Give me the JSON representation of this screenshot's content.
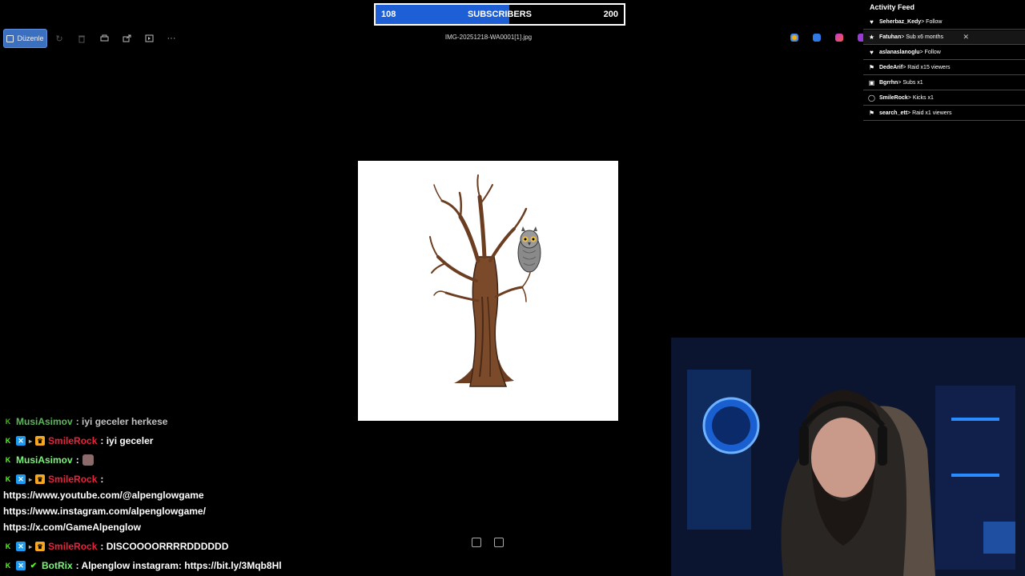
{
  "subscribers": {
    "current": "108",
    "title": "SUBSCRIBERS",
    "goal": "200",
    "progress": 0.54,
    "fill_color": "#1f5fd6"
  },
  "viewer": {
    "edit_label": "Düzenle",
    "filename": "IMG-20251218-WA0001[1].jpg",
    "icons": [
      "rotate-icon",
      "delete-icon",
      "print-icon",
      "share-icon",
      "slideshow-icon",
      "more-icon"
    ]
  },
  "activity_feed": {
    "title": "Activity Feed",
    "items": [
      {
        "icon": "heart-icon",
        "user": "Seherbaz_Kedy",
        "action": " > Follow"
      },
      {
        "icon": "star-icon",
        "user": "Fatuhan",
        "action": " > Sub x6 months"
      },
      {
        "icon": "heart-icon",
        "user": "aslanaslanoglu",
        "action": " > Follow"
      },
      {
        "icon": "raid-icon",
        "user": "DedeArif",
        "action": " > Raid x15 viewers"
      },
      {
        "icon": "gift-icon",
        "user": "Bgrrhn",
        "action": " > Subs x1"
      },
      {
        "icon": "kick-icon",
        "user": "SmileRock",
        "action": " > Kicks x1"
      },
      {
        "icon": "raid-icon",
        "user": "search_ett",
        "action": " > Raid x1 viewers"
      }
    ]
  },
  "chat": {
    "messages": [
      {
        "user": "MusiAsimov",
        "text": " : iyi geceler herkese"
      },
      {
        "user": "SmileRock",
        "text": " : iyi geceler"
      },
      {
        "user": "MusiAsimov",
        "text": " :"
      },
      {
        "user": "SmileRock",
        "text": " :"
      },
      {
        "user": "SmileRock",
        "text": " : DISCOOOORRRRDDDDDD"
      },
      {
        "user": "BotRix",
        "text": " : Alpenglow instagram: https://bit.ly/3Mqb8Hl"
      }
    ],
    "links": [
      "https://www.youtube.com/@alpenglowgame",
      "https://www.instagram.com/alpenglowgame/",
      "https://x.com/GameAlpenglow"
    ]
  }
}
